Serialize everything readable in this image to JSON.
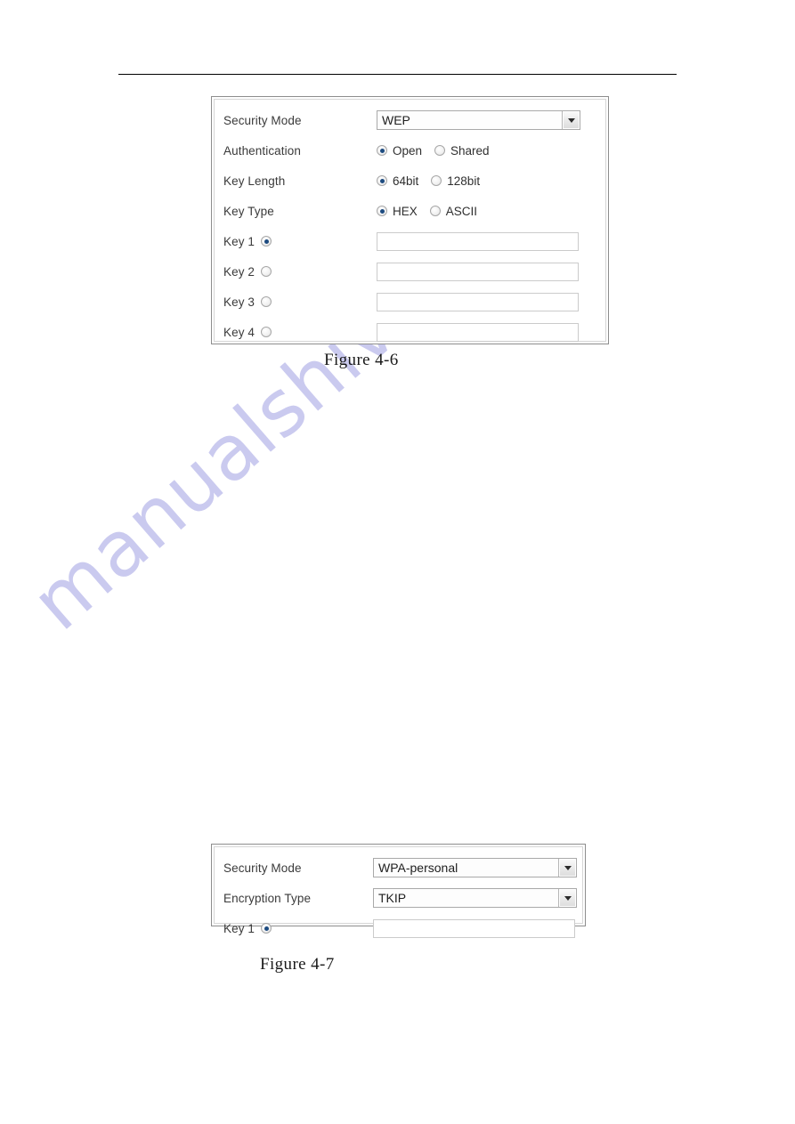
{
  "document": {
    "watermark_text": "manualshive.com",
    "watermark_color": "#cacaef",
    "header_rule_color": "#000000"
  },
  "figure_4_6": {
    "caption": "Figure 4-6",
    "rows": {
      "security_mode": {
        "label": "Security Mode",
        "selected": "WEP",
        "options": [
          "WEP"
        ]
      },
      "authentication": {
        "label": "Authentication",
        "options": [
          {
            "label": "Open",
            "checked": true
          },
          {
            "label": "Shared",
            "checked": false
          }
        ]
      },
      "key_length": {
        "label": "Key Length",
        "options": [
          {
            "label": "64bit",
            "checked": true
          },
          {
            "label": "128bit",
            "checked": false
          }
        ]
      },
      "key_type": {
        "label": "Key Type",
        "options": [
          {
            "label": "HEX",
            "checked": true
          },
          {
            "label": "ASCII",
            "checked": false
          }
        ]
      },
      "keys": [
        {
          "label": "Key 1",
          "checked": true,
          "value": "",
          "placeholder": ""
        },
        {
          "label": "Key 2",
          "checked": false,
          "value": "",
          "placeholder": ""
        },
        {
          "label": "Key 3",
          "checked": false,
          "value": "",
          "placeholder": ""
        },
        {
          "label": "Key 4",
          "checked": false,
          "value": "",
          "placeholder": ""
        }
      ]
    }
  },
  "figure_4_7": {
    "caption": "Figure 4-7",
    "rows": {
      "security_mode": {
        "label": "Security Mode",
        "selected": "WPA-personal",
        "options": [
          "WPA-personal"
        ]
      },
      "encryption_type": {
        "label": "Encryption Type",
        "selected": "TKIP",
        "options": [
          "TKIP"
        ]
      },
      "keys": [
        {
          "label": "Key 1",
          "checked": true,
          "value": "",
          "placeholder": ""
        }
      ]
    }
  }
}
